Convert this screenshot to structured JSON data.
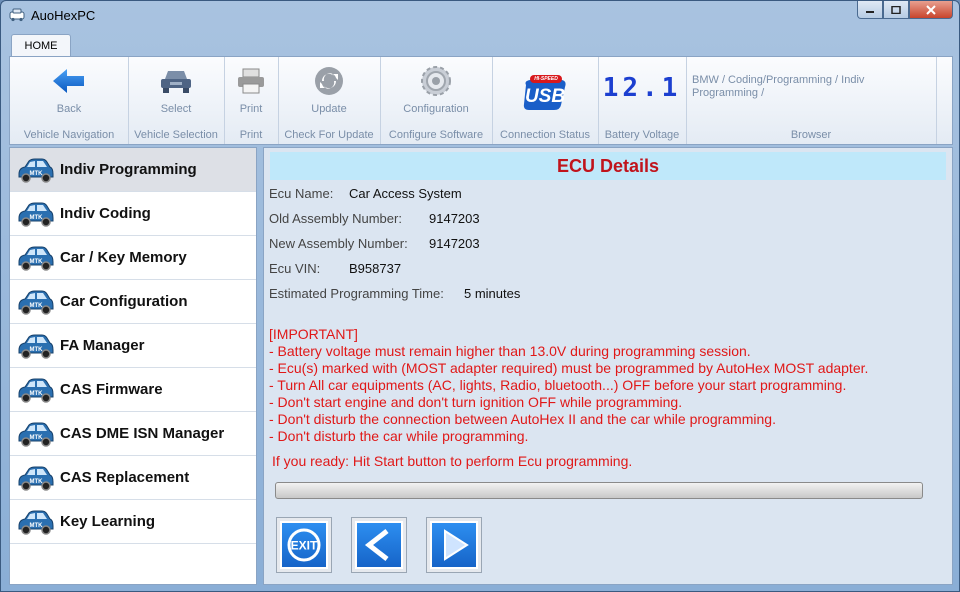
{
  "window": {
    "title": "AuoHexPC",
    "min_icon": "minimize-icon",
    "max_icon": "maximize-icon",
    "close_icon": "close-icon"
  },
  "tabs": [
    {
      "label": "HOME",
      "active": true
    }
  ],
  "ribbon": {
    "groups": [
      {
        "button": "Back",
        "label": "Vehicle Navigation",
        "icon": "back-arrow-icon"
      },
      {
        "button": "Select",
        "label": "Vehicle Selection",
        "icon": "car-front-icon"
      },
      {
        "button": "Print",
        "label": "Print",
        "icon": "printer-icon"
      },
      {
        "button": "Update",
        "label": "Check For Update",
        "icon": "refresh-icon"
      },
      {
        "button": "Configuration",
        "label": "Configure Software",
        "icon": "gear-icon"
      },
      {
        "button": "",
        "label": "Connection Status",
        "icon": "usb-icon"
      },
      {
        "button": "12.1",
        "label": "Battery Voltage",
        "icon": "lcd-digits-icon"
      },
      {
        "button": "",
        "label": "Browser",
        "icon": ""
      }
    ],
    "browser_path": "BMW / Coding/Programming / Indiv Programming /",
    "usb_badge_small": "HI-SPEED",
    "usb_badge_text": "USB"
  },
  "sidebar": {
    "items": [
      {
        "label": "Indiv Programming",
        "active": true
      },
      {
        "label": "Indiv Coding",
        "active": false
      },
      {
        "label": "Car / Key Memory",
        "active": false
      },
      {
        "label": "Car Configuration",
        "active": false
      },
      {
        "label": "FA Manager",
        "active": false
      },
      {
        "label": "CAS Firmware",
        "active": false
      },
      {
        "label": "CAS DME ISN Manager",
        "active": false
      },
      {
        "label": "CAS Replacement",
        "active": false
      },
      {
        "label": "Key Learning",
        "active": false
      }
    ],
    "item_icon": "car-mtk-icon",
    "car_badge": "MTK"
  },
  "ecu": {
    "header": "ECU Details",
    "name_label": "Ecu Name:",
    "name_value": "Car Access System",
    "old_label": "Old Assembly Number:",
    "old_value": "9147203",
    "new_label": "New Assembly Number:",
    "new_value": "9147203",
    "vin_label": "Ecu VIN:",
    "vin_value": "B958737",
    "time_label": "Estimated Programming Time:",
    "time_value": "5 minutes",
    "warnings": [
      "[IMPORTANT]",
      "- Battery voltage must remain higher than 13.0V during programming session.",
      "- Ecu(s) marked with (MOST adapter required) must be programmed by AutoHex MOST adapter.",
      "- Turn All car equipments (AC, lights, Radio, bluetooth...) OFF before your start programming.",
      "- Don't start engine and don't turn ignition OFF while programming.",
      "- Don't disturb the connection between AutoHex II and the car while programming.",
      "- Don't disturb the car while programming."
    ],
    "ready": "If you ready: Hit Start button to perform Ecu programming.",
    "progress": 0
  },
  "buttons": {
    "exit_label": "EXIT",
    "exit_icon": "exit-icon",
    "back_icon": "chevron-left-icon",
    "start_icon": "play-icon"
  },
  "colors": {
    "accent_red": "#c0141c",
    "warning_red": "#e01818",
    "button_blue": "#1e78e0",
    "header_bg": "#bfe8fa"
  }
}
